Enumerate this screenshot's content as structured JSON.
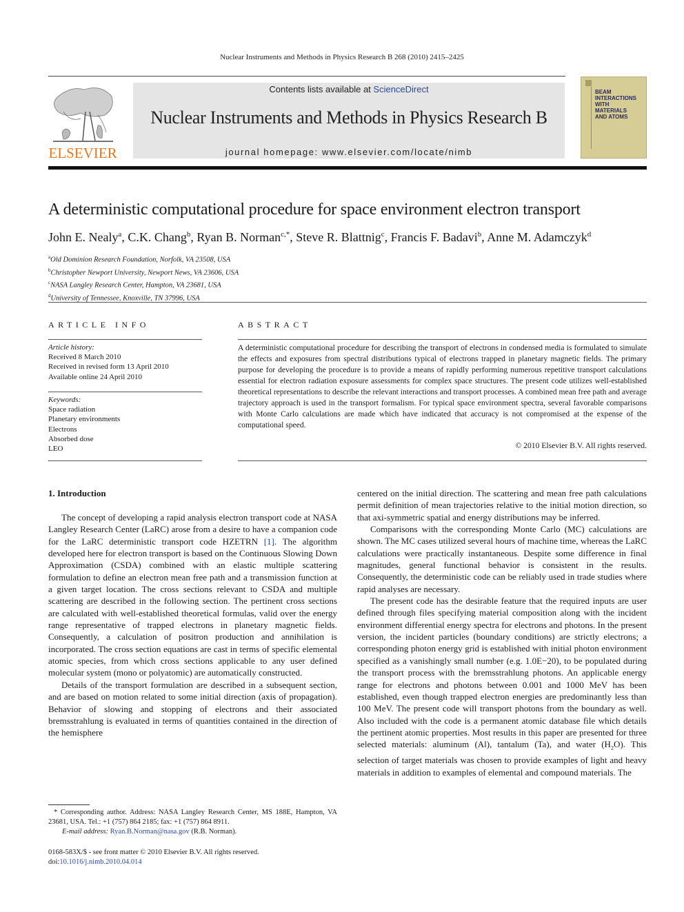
{
  "running_head": "Nuclear Instruments and Methods in Physics Research B 268 (2010) 2415–2425",
  "header": {
    "publisher_logo_text": "ELSEVIER",
    "contents_prefix": "Contents lists available at ",
    "contents_link": "ScienceDirect",
    "journal_title": "Nuclear Instruments and Methods in Physics Research B",
    "homepage": "journal homepage: www.elsevier.com/locate/nimb",
    "cover_text": "BEAM\nINTERACTIONS\nWITH\nMATERIALS\nAND ATOMS"
  },
  "article": {
    "title": "A deterministic computational procedure for space environment electron transport",
    "authors": [
      {
        "name": "John E. Nealy",
        "sup": "a"
      },
      {
        "name": "C.K. Chang",
        "sup": "b"
      },
      {
        "name": "Ryan B. Norman",
        "sup": "c,*"
      },
      {
        "name": "Steve R. Blattnig",
        "sup": "c"
      },
      {
        "name": "Francis F. Badavi",
        "sup": "b"
      },
      {
        "name": "Anne M. Adamczyk",
        "sup": "d"
      }
    ],
    "affiliations": [
      {
        "sup": "a",
        "text": "Old Dominion Research Foundation, Norfolk, VA 23508, USA"
      },
      {
        "sup": "b",
        "text": "Christopher Newport University, Newport News, VA 23606, USA"
      },
      {
        "sup": "c",
        "text": "NASA Langley Research Center, Hampton, VA 23681, USA"
      },
      {
        "sup": "d",
        "text": "University of Tennessee, Knoxville, TN 37996, USA"
      }
    ]
  },
  "article_info": {
    "heading": "ARTICLE INFO",
    "history_label": "Article history:",
    "history": [
      "Received 8 March 2010",
      "Received in revised form 13 April 2010",
      "Available online 24 April 2010"
    ],
    "keywords_label": "Keywords:",
    "keywords": [
      "Space radiation",
      "Planetary environments",
      "Electrons",
      "Absorbed dose",
      "LEO"
    ]
  },
  "abstract": {
    "heading": "ABSTRACT",
    "text": "A deterministic computational procedure for describing the transport of electrons in condensed media is formulated to simulate the effects and exposures from spectral distributions typical of electrons trapped in planetary magnetic fields. The primary purpose for developing the procedure is to provide a means of rapidly performing numerous repetitive transport calculations essential for electron radiation exposure assessments for complex space structures. The present code utilizes well-established theoretical representations to describe the relevant interactions and transport processes. A combined mean free path and average trajectory approach is used in the transport formalism. For typical space environment spectra, several favorable comparisons with Monte Carlo calculations are made which have indicated that accuracy is not compromised at the expense of the computational speed.",
    "copyright": "© 2010 Elsevier B.V. All rights reserved."
  },
  "body": {
    "section_heading": "1. Introduction",
    "left_p1_before_ref": "The concept of developing a rapid analysis electron transport code at NASA Langley Research Center (LaRC) arose from a desire to have a companion code for the LaRC deterministic transport code HZETRN ",
    "left_p1_ref": "[1]",
    "left_p1_after_ref": ". The algorithm developed here for electron transport is based on the Continuous Slowing Down Approximation (CSDA) combined with an elastic multiple scattering formulation to define an electron mean free path and a transmission function at a given target location. The cross sections relevant to CSDA and multiple scattering are described in the following section. The pertinent cross sections are calculated with well-established theoretical formulas, valid over the energy range representative of trapped electrons in planetary magnetic fields. Consequently, a calculation of positron production and annihilation is incorporated. The cross section equations are cast in terms of specific elemental atomic species, from which cross sections applicable to any user defined molecular system (mono or polyatomic) are automatically constructed.",
    "left_p2": "Details of the transport formulation are described in a subsequent section, and are based on motion related to some initial direction (axis of propagation). Behavior of slowing and stopping of electrons and their associated bremsstrahlung is evaluated in terms of quantities contained in the direction of the hemisphere",
    "right_p1": "centered on the initial direction. The scattering and mean free path calculations permit definition of mean trajectories relative to the initial motion direction, so that axi-symmetric spatial and energy distributions may be inferred.",
    "right_p2": "Comparisons with the corresponding Monte Carlo (MC) calculations are shown. The MC cases utilized several hours of machine time, whereas the LaRC calculations were practically instantaneous. Despite some difference in final magnitudes, general functional behavior is consistent in the results. Consequently, the deterministic code can be reliably used in trade studies where rapid analyses are necessary.",
    "right_p3_before_sub": "The present code has the desirable feature that the required inputs are user defined through files specifying material composition along with the incident environment differential energy spectra for electrons and photons. In the present version, the incident particles (boundary conditions) are strictly electrons; a corresponding photon energy grid is established with initial photon environment specified as a vanishingly small number (e.g. 1.0E−20), to be populated during the transport process with the bremsstrahlung photons. An applicable energy range for electrons and photons between 0.001 and 1000 MeV has been established, even though trapped electron energies are predominantly less than 100 MeV. The present code will transport photons from the boundary as well. Also included with the code is a permanent atomic database file which details the pertinent atomic properties. Most results in this paper are presented for three selected materials: aluminum (Al), tantalum (Ta), and water (H",
    "right_p3_sub": "2",
    "right_p3_after_sub": "O). This selection of target materials was chosen to provide examples of light and heavy materials in addition to examples of elemental and compound materials. The"
  },
  "footnote": {
    "corresponding": "* Corresponding author. Address: NASA Langley Research Center, MS 188E, Hampton, VA 23681, USA. Tel.: +1 (757) 864 2185; fax: +1 (757) 864 8911.",
    "email_label": "E-mail address: ",
    "email": "Ryan.B.Norman@nasa.gov",
    "email_suffix": " (R.B. Norman).",
    "front_matter": "0168-583X/$ - see front matter © 2010 Elsevier B.V. All rights reserved.",
    "doi_label": "doi:",
    "doi": "10.1016/j.nimb.2010.04.014"
  },
  "colors": {
    "link": "#2a4a9a",
    "elsevier_orange": "#e8781e",
    "banner_gray": "#e5e5e5",
    "cover_tan": "#d6cc96"
  }
}
